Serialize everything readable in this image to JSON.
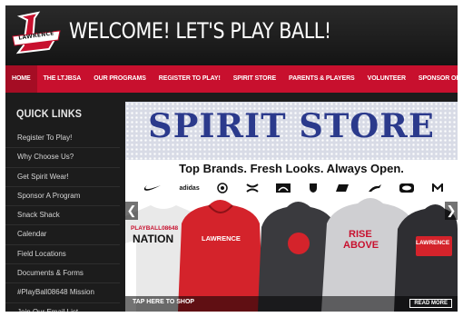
{
  "header": {
    "title": "WELCOME! LET'S PLAY BALL!",
    "logo_text": "LAWRENCE"
  },
  "nav": {
    "items": [
      {
        "label": "HOME"
      },
      {
        "label": "THE LTJBSA"
      },
      {
        "label": "OUR PROGRAMS"
      },
      {
        "label": "REGISTER TO PLAY!"
      },
      {
        "label": "SPIRIT STORE"
      },
      {
        "label": "PARENTS & PLAYERS"
      },
      {
        "label": "VOLUNTEER"
      },
      {
        "label": "SPONSOR OR DONATE"
      }
    ]
  },
  "sidebar": {
    "title": "QUICK LINKS",
    "items": [
      {
        "label": "Register To Play!"
      },
      {
        "label": "Why Choose Us?"
      },
      {
        "label": "Get Spirit Wear!"
      },
      {
        "label": "Sponsor A Program"
      },
      {
        "label": "Snack Shack"
      },
      {
        "label": "Calendar"
      },
      {
        "label": "Field Locations"
      },
      {
        "label": "Documents & Forms"
      },
      {
        "label": "#PlayBall08648 Mission"
      },
      {
        "label": "Join Our Email List"
      }
    ]
  },
  "banner": {
    "title": "SPIRIT STORE",
    "tagline": "Top Brands. Fresh Looks. Always Open.",
    "brands": [
      "nike-logo",
      "adidas",
      "brand-seal-logo",
      "under-armour-logo",
      "the-north-face-logo",
      "brand-shield-logo",
      "new-era-logo",
      "puma-logo",
      "oakley-logo",
      "brand-m-logo"
    ],
    "adidas_label": "adidas",
    "shirts": {
      "s1_line1": "PLAYBALL08648",
      "s1_line2": "NATION",
      "s2_line1": "LAWRENCE",
      "s4_line1": "RISE",
      "s4_line2": "ABOVE",
      "s5_line1": "LAWRENCE"
    },
    "cta": "TAP HERE TO SHOP",
    "read_more": "READ MORE"
  },
  "colors": {
    "nav_red": "#c8102e",
    "title_blue": "#2b3a8c",
    "dark_bg": "#1c1c1c"
  }
}
